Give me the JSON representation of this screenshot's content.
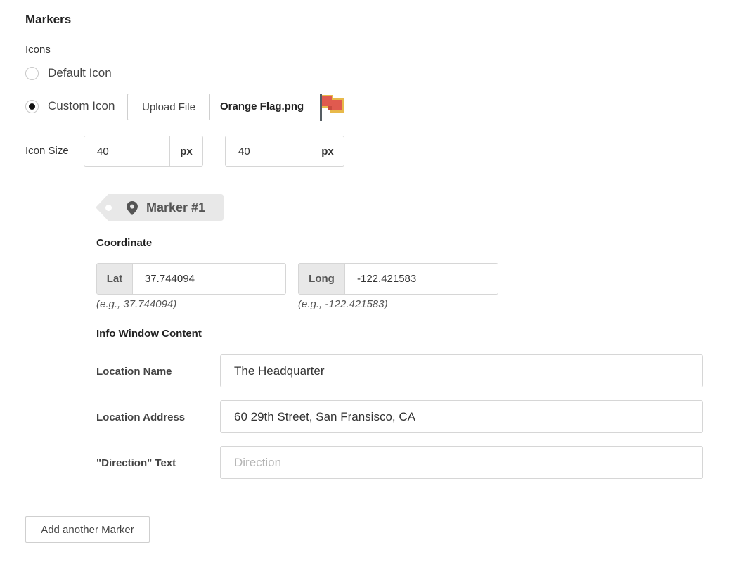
{
  "section": {
    "title": "Markers"
  },
  "icons": {
    "label": "Icons",
    "options": [
      {
        "label": "Default Icon",
        "selected": false
      },
      {
        "label": "Custom Icon",
        "selected": true
      }
    ],
    "upload_label": "Upload File",
    "file_name": "Orange Flag.png",
    "preview_icon": "orange-flag-icon"
  },
  "icon_size": {
    "label": "Icon Size",
    "width": "40",
    "height": "40",
    "unit": "px"
  },
  "marker": {
    "label": "Marker #1",
    "icon": "map-pin-icon",
    "coordinate": {
      "title": "Coordinate",
      "lat_label": "Lat",
      "lat_value": "37.744094",
      "lat_hint": "(e.g., 37.744094)",
      "long_label": "Long",
      "long_value": "-122.421583",
      "long_hint": "(e.g., -122.421583)"
    },
    "info_window": {
      "title": "Info Window Content",
      "location_name_label": "Location Name",
      "location_name_value": "The Headquarter",
      "location_address_label": "Location Address",
      "location_address_value": "60 29th Street, San Fransisco, CA",
      "direction_label": "\"Direction\" Text",
      "direction_value": "",
      "direction_placeholder": "Direction"
    }
  },
  "actions": {
    "add_marker_label": "Add another Marker"
  },
  "colors": {
    "flag_red": "#e05a4f",
    "flag_gold": "#e8b94a",
    "tag_bg": "#e8e8e8",
    "border": "#d6d6d6"
  }
}
